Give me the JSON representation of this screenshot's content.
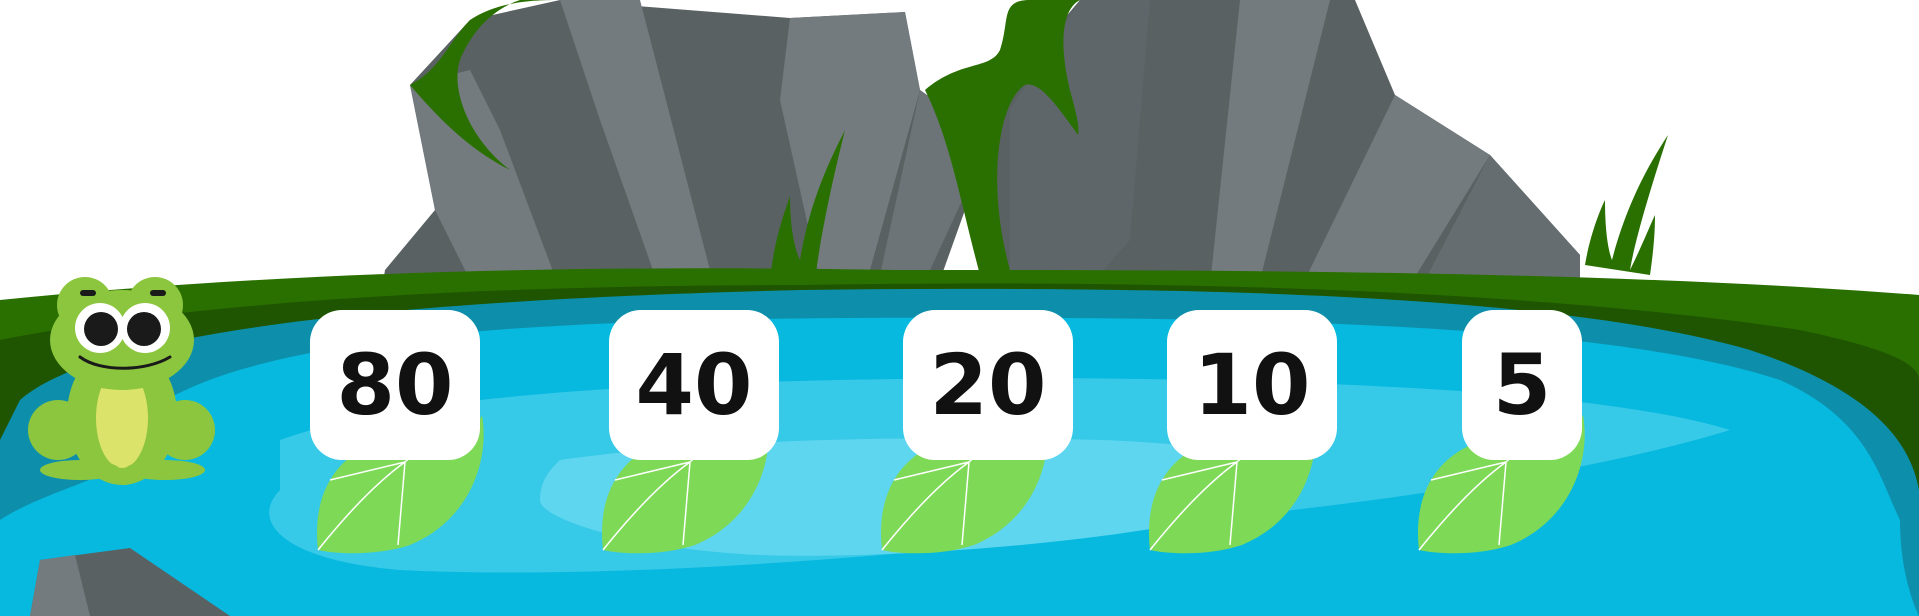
{
  "game": {
    "numbers": [
      "80",
      "40",
      "20",
      "10",
      "5"
    ]
  },
  "colors": {
    "grass": "#2a7000",
    "grass_dark": "#1f5500",
    "water_edge": "#0d8fab",
    "water": "#07b8df",
    "water_light": "#37c9e8",
    "water_highlight": "#5fd6ef",
    "rock_light": "#737b7e",
    "rock_dark": "#5a6163",
    "lily_pad": "#7ed957",
    "frog_body": "#8cc63e",
    "frog_belly": "#dbe36a"
  },
  "icons": {
    "character": "frog-icon",
    "pad": "lily-pad-icon"
  }
}
